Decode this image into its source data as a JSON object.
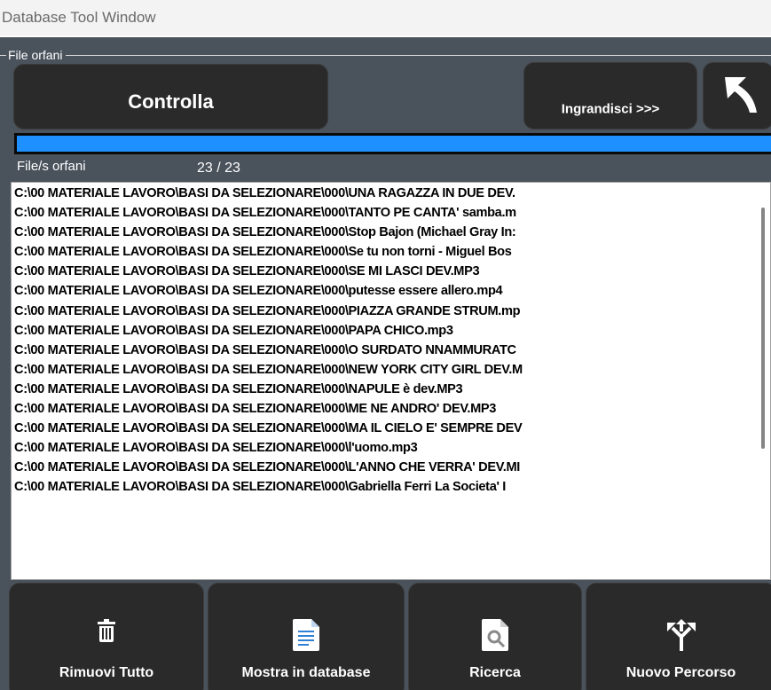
{
  "window": {
    "title": "Database Tool Window"
  },
  "group": {
    "title": "File orfani"
  },
  "toolbar": {
    "check_label": "Controlla",
    "enlarge_label": "Ingrandisci >>>",
    "back_icon": "back-arrow-icon"
  },
  "progress": {
    "fraction": 1.0,
    "color": "#1e90ff"
  },
  "list": {
    "label": "File/s orfani",
    "count": "23 / 23",
    "items": [
      "C:\\00 MATERIALE LAVORO\\BASI DA SELEZIONARE\\000\\UNA RAGAZZA IN DUE DEV.",
      "C:\\00 MATERIALE LAVORO\\BASI DA SELEZIONARE\\000\\TANTO PE CANTA'  samba.m",
      "C:\\00 MATERIALE LAVORO\\BASI DA SELEZIONARE\\000\\Stop Bajon (Michael Gray In:",
      "C:\\00 MATERIALE LAVORO\\BASI DA SELEZIONARE\\000\\Se tu non torni - Miguel Bos",
      "C:\\00 MATERIALE LAVORO\\BASI DA SELEZIONARE\\000\\SE MI LASCI DEV.MP3",
      "C:\\00 MATERIALE LAVORO\\BASI DA SELEZIONARE\\000\\putesse essere allero.mp4",
      "C:\\00 MATERIALE LAVORO\\BASI DA SELEZIONARE\\000\\PIAZZA GRANDE STRUM.mp",
      "C:\\00 MATERIALE LAVORO\\BASI DA SELEZIONARE\\000\\PAPA CHICO.mp3",
      "C:\\00 MATERIALE LAVORO\\BASI DA SELEZIONARE\\000\\O SURDATO NNAMMURATC",
      "C:\\00 MATERIALE LAVORO\\BASI DA SELEZIONARE\\000\\NEW YORK CITY GIRL DEV.M",
      "C:\\00 MATERIALE LAVORO\\BASI DA SELEZIONARE\\000\\NAPULE è dev.MP3",
      "C:\\00 MATERIALE LAVORO\\BASI DA SELEZIONARE\\000\\ME NE ANDRO' DEV.MP3",
      "C:\\00 MATERIALE LAVORO\\BASI DA SELEZIONARE\\000\\MA IL CIELO E' SEMPRE DEV",
      "C:\\00 MATERIALE LAVORO\\BASI DA SELEZIONARE\\000\\l'uomo.mp3",
      "C:\\00 MATERIALE LAVORO\\BASI DA SELEZIONARE\\000\\L'ANNO CHE VERRA' DEV.MI",
      "C:\\00 MATERIALE LAVORO\\BASI DA SELEZIONARE\\000\\Gabriella Ferri   La Societa' I"
    ]
  },
  "actions": {
    "remove_all": {
      "label": "Rimuovi Tutto",
      "icon": "trash-icon"
    },
    "show_in_db": {
      "label": "Mostra in database",
      "icon": "document-icon"
    },
    "search": {
      "label": "Ricerca",
      "icon": "search-document-icon"
    },
    "new_path": {
      "label": "Nuovo Percorso",
      "icon": "split-path-icon"
    }
  }
}
